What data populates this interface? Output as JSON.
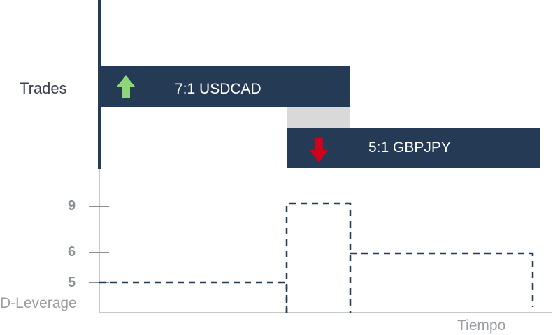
{
  "lane_label": "Trades",
  "trades": [
    {
      "label": "7:1 USDCAD",
      "direction": "up",
      "icon": "arrow-up-icon",
      "color": "#253a55",
      "icon_color": "#8fd67a"
    },
    {
      "label": "5:1 GBPJPY",
      "direction": "down",
      "icon": "arrow-down-icon",
      "color": "#253a55",
      "icon_color": "#d0021b"
    }
  ],
  "overlap_color": "#d9d9d9",
  "leverage_axis": {
    "label": "D-Leverage",
    "ticks": [
      "9",
      "6",
      "5"
    ]
  },
  "time_axis": {
    "label": "Tiempo"
  },
  "leverage_levels": [
    5,
    9,
    6
  ]
}
